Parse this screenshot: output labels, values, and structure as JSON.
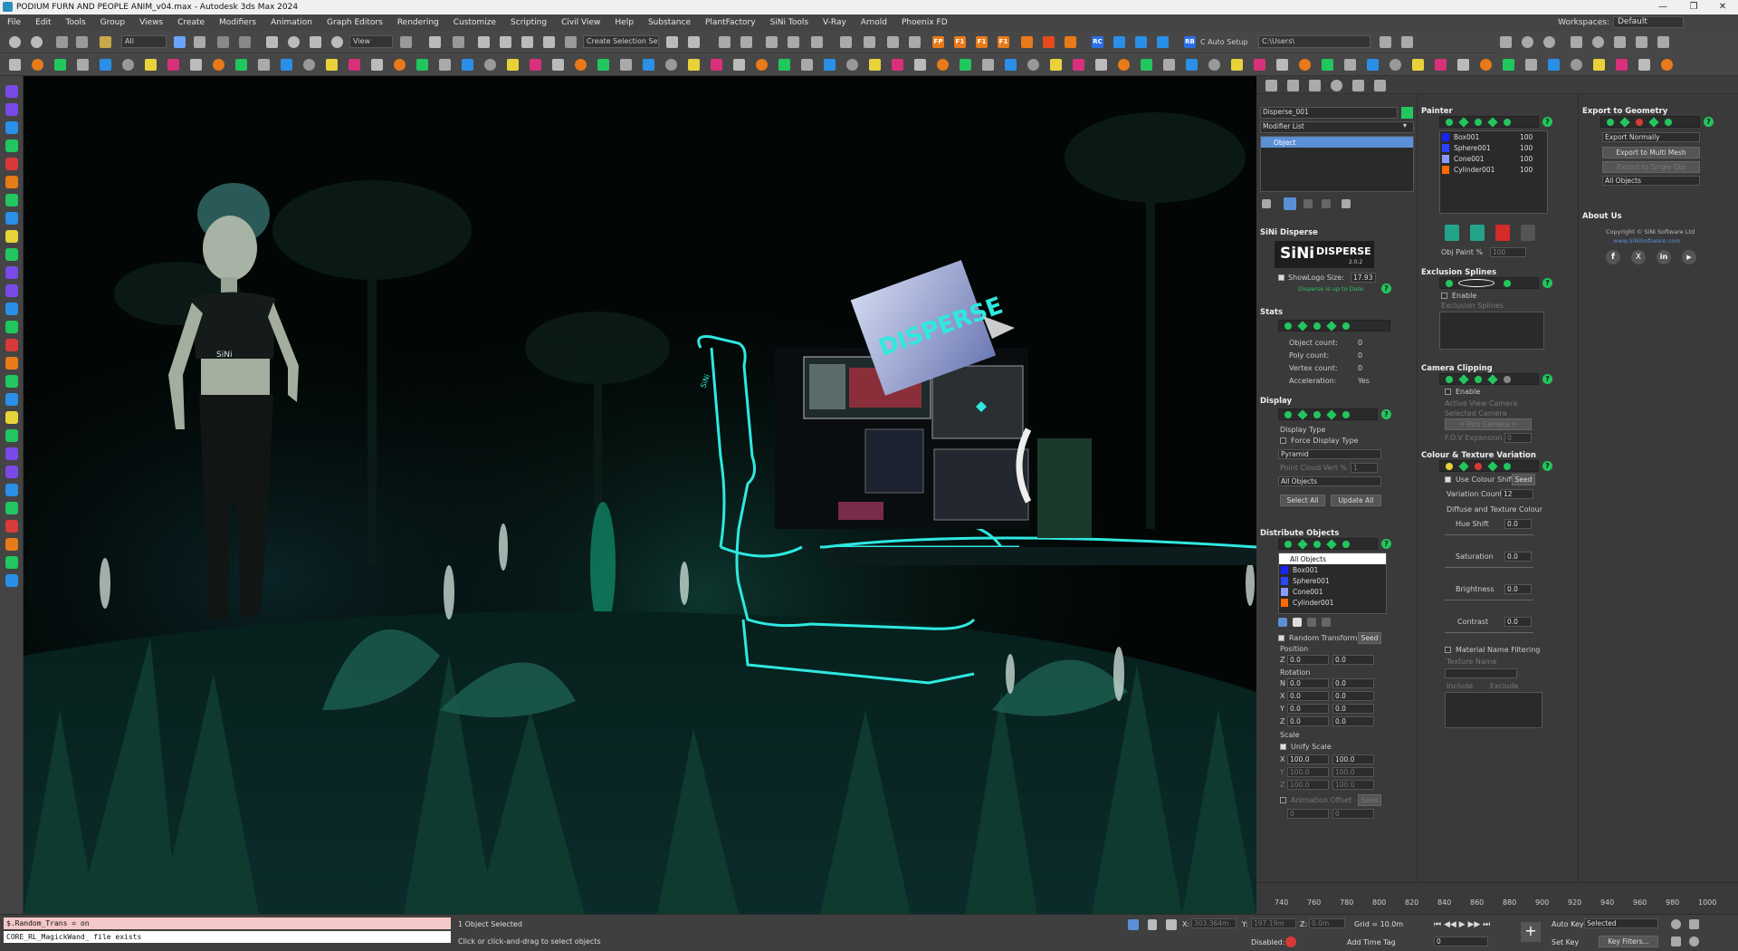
{
  "window": {
    "title": "PODIUM FURN AND PEOPLE ANIM_v04.max - Autodesk 3ds Max 2024",
    "controls": [
      "—",
      "❐",
      "✕"
    ]
  },
  "menu": {
    "items": [
      "File",
      "Edit",
      "Tools",
      "Group",
      "Views",
      "Create",
      "Modifiers",
      "Animation",
      "Graph Editors",
      "Rendering",
      "Customize",
      "Scripting",
      "Civil View",
      "Help",
      "Substance",
      "PlantFactory",
      "SiNi Tools",
      "V-Ray",
      "Arnold",
      "Phoenix FD"
    ],
    "workspaces_label": "Workspaces:",
    "workspaces_value": "Default"
  },
  "toolbar": {
    "filter_all": "All",
    "view": "View",
    "create_selection_set": "Create Selection Se",
    "auto_setup": "C Auto Setup",
    "path": "C:\\Users\\",
    "badges": [
      "FP",
      "F1",
      "F1",
      "F1",
      "RC",
      "RB"
    ]
  },
  "command_panel": {
    "object_name": "Disperse_001",
    "object_color": "#22c65e",
    "modifier_list": "Modifier List",
    "stack_item": "Object"
  },
  "sini_disperse": {
    "header": "SiNi Disperse",
    "logo_text": "DISPERSE",
    "logo_version": "2.0.2",
    "show_logo": "Show",
    "logo_size_label": "Logo Size:",
    "logo_size_value": "17.93",
    "update_msg": "Disperse is up to Date"
  },
  "stats": {
    "header": "Stats",
    "rows": [
      {
        "label": "Object count:",
        "value": "0"
      },
      {
        "label": "Poly count:",
        "value": "0"
      },
      {
        "label": "Vertex count:",
        "value": "0"
      },
      {
        "label": "Acceleration:",
        "value": "Yes"
      }
    ]
  },
  "display": {
    "header": "Display",
    "type_label": "Display Type",
    "force_label": "Force Display Type",
    "type_value": "Pyramid",
    "cloud_label": "Point Cloud Vert %",
    "cloud_value": "1",
    "objects_value": "All Objects",
    "select_all": "Select All",
    "update_all": "Update All"
  },
  "distribute": {
    "header": "Distribute Objects",
    "items": [
      {
        "name": "All Objects",
        "color": ""
      },
      {
        "name": "Box001",
        "color": "#1a22ff"
      },
      {
        "name": "Sphere001",
        "color": "#2a44ff"
      },
      {
        "name": "Cone001",
        "color": "#8a9cff"
      },
      {
        "name": "Cylinder001",
        "color": "#ff6a00"
      }
    ],
    "random_transform": "Random Transform",
    "seed": "Seed",
    "position_label": "Position",
    "position": [
      {
        "axis": "Z",
        "min": "0.0",
        "max": "0.0"
      }
    ],
    "rotation_label": "Rotation",
    "rotation": [
      {
        "axis": "N",
        "min": "0.0",
        "max": "0.0"
      },
      {
        "axis": "X",
        "min": "0.0",
        "max": "0.0"
      },
      {
        "axis": "Y",
        "min": "0.0",
        "max": "0.0"
      },
      {
        "axis": "Z",
        "min": "0.0",
        "max": "0.0"
      }
    ],
    "scale_label": "Scale",
    "unify_scale": "Unify Scale",
    "scale": [
      {
        "axis": "X",
        "min": "100.0",
        "max": "100.0"
      },
      {
        "axis": "Y",
        "min": "100.0",
        "max": "100.0"
      },
      {
        "axis": "Z",
        "min": "100.0",
        "max": "100.0"
      }
    ],
    "anim_offset": "Animation Offset",
    "anim_seed": "Seed",
    "anim_min": "0",
    "anim_max": "0"
  },
  "painter": {
    "header": "Painter",
    "items": [
      {
        "name": "Box001",
        "value": "100",
        "color": "#1a22ff"
      },
      {
        "name": "Sphere001",
        "value": "100",
        "color": "#2a44ff"
      },
      {
        "name": "Cone001",
        "value": "100",
        "color": "#8a9cff"
      },
      {
        "name": "Cylinder001",
        "value": "100",
        "color": "#ff6a00"
      }
    ],
    "obj_paint_label": "Obj Paint %",
    "obj_paint_value": "100"
  },
  "exclusion": {
    "header": "Exclusion Splines",
    "enable": "Enable",
    "splines_label": "Exclusion Splines"
  },
  "camera_clipping": {
    "header": "Camera Clipping",
    "enable": "Enable",
    "active_view": "Active View Camera",
    "selected_camera": "Selected Camera",
    "pick_camera": "< Pick Camera >",
    "fov_label": "F.O.V Expansion",
    "fov_value": "0"
  },
  "colour_variation": {
    "header": "Colour & Texture Variation",
    "use_colour_shift": "Use Colour Shift",
    "seed": "Seed",
    "variation_label": "Variation Count",
    "variation_value": "12",
    "diffuse_label": "Diffuse and Texture Colour",
    "sliders": [
      {
        "label": "Hue Shift",
        "value": "0.0"
      },
      {
        "label": "Saturation",
        "value": "0.0"
      },
      {
        "label": "Brightness",
        "value": "0.0"
      },
      {
        "label": "Contrast",
        "value": "0.0"
      }
    ],
    "mat_filter": "Material Name Filtering",
    "texture_name": "Texture Name",
    "include": "Include",
    "exclude": "Exclude"
  },
  "export": {
    "header": "Export to Geometry",
    "mode": "Export Normally",
    "multi_mesh": "Export to Multi Mesh",
    "single_obj": "Export to Single Obj",
    "objects": "All Objects"
  },
  "about": {
    "header": "About Us",
    "copyright": "Copyright © SiNi Software Ltd",
    "link": "www.SiNiSoftware.com",
    "social": [
      "f",
      "X",
      "in",
      "▶"
    ]
  },
  "timeline": {
    "ticks": [
      "740",
      "760",
      "780",
      "800",
      "820",
      "840",
      "860",
      "880",
      "900",
      "920",
      "940",
      "960",
      "980",
      "1000"
    ]
  },
  "maxscript": {
    "line1": "$.Random_Trans = on",
    "line2": "CORE_RL_MagickWand_ file exists"
  },
  "status": {
    "selected": "1 Object Selected",
    "prompt": "Click or click-and-drag to select objects",
    "x_label": "X:",
    "x_value": "303.364m",
    "y_label": "Y:",
    "y_value": "197.19m",
    "z_label": "Z:",
    "z_value": "0.0m",
    "grid": "Grid = 10.0m",
    "disabled": "Disabled:",
    "add_time_tag": "Add Time Tag",
    "auto_key": "Auto Key",
    "selected_dd": "Selected",
    "set_key": "Set Key",
    "key_filters": "Key Filters...",
    "frame": "0"
  },
  "viewport": {
    "screen_logo": "DISPERSE",
    "shirt_logo": "SiNi",
    "chair_logo": "SiNi"
  },
  "colors": {
    "accent_green": "#22c65e",
    "neon_cyan": "#2fe8e0",
    "viewport_bg": "#020605"
  }
}
